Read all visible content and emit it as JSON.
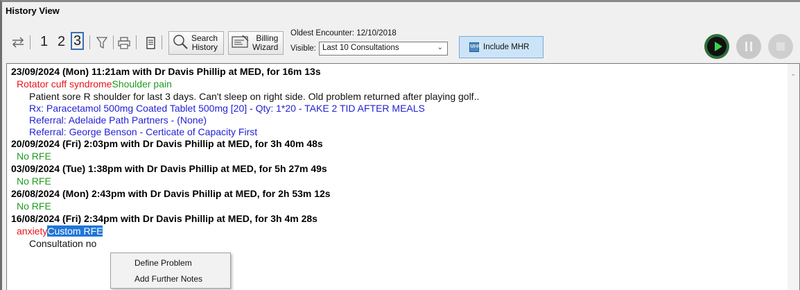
{
  "window": {
    "title": "History View"
  },
  "toolbar": {
    "page_numbers": [
      "1",
      "2",
      "3"
    ],
    "selected_page": "3",
    "search_history": [
      "Search",
      "History"
    ],
    "billing_wizard": [
      "Billing",
      "Wizard"
    ],
    "oldest_encounter": "Oldest Encounter: 12/10/2018",
    "visible_label": "Visible:",
    "visible_value": "Last 10 Consultations",
    "include_mhr": "Include MHR",
    "mhr_icon_text": "MHR"
  },
  "consultations": [
    {
      "header": "23/09/2024 (Mon) 11:21am with Dr Davis Phillip at MED, for 16m 13s",
      "problem": "Rotator cuff syndrome",
      "rfe": "Shoulder pain",
      "notes": "Patient sore R shoulder for last 3 days. Can't sleep on right side. Old problem returned after playing golf..",
      "rx": "Rx: Paracetamol 500mg Coated Tablet 500mg [20] - Qty: 1*20 - TAKE 2 TID AFTER MEALS",
      "referral_1": "Referral: Adelaide Path Partners - (None)",
      "referral_2": "Referral: George Benson - Certicate of Capacity First"
    },
    {
      "header": "20/09/2024 (Fri) 2:03pm with Dr Davis Phillip at MED, for 3h 40m 48s",
      "rfe": "No RFE"
    },
    {
      "header": "03/09/2024 (Tue) 1:38pm with Dr Davis Phillip at MED, for 5h 27m 49s",
      "rfe": "No RFE"
    },
    {
      "header": "26/08/2024 (Mon) 2:43pm with Dr Davis Phillip at MED, for 2h 53m 12s",
      "rfe": "No RFE"
    },
    {
      "header": "16/08/2024 (Fri) 2:34pm with Dr Davis Phillip at MED, for 3h 4m 28s",
      "problem": "anxiety",
      "rfe": "Custom RFE",
      "notes_partial": "Consultation no"
    }
  ],
  "context_menu": {
    "items": [
      "Define Problem",
      "Add Further Notes"
    ]
  },
  "colors": {
    "problem": "#e8141a",
    "rfe": "#1f9b1f",
    "action": "#1f1fd6",
    "selection": "#1f76d8"
  }
}
